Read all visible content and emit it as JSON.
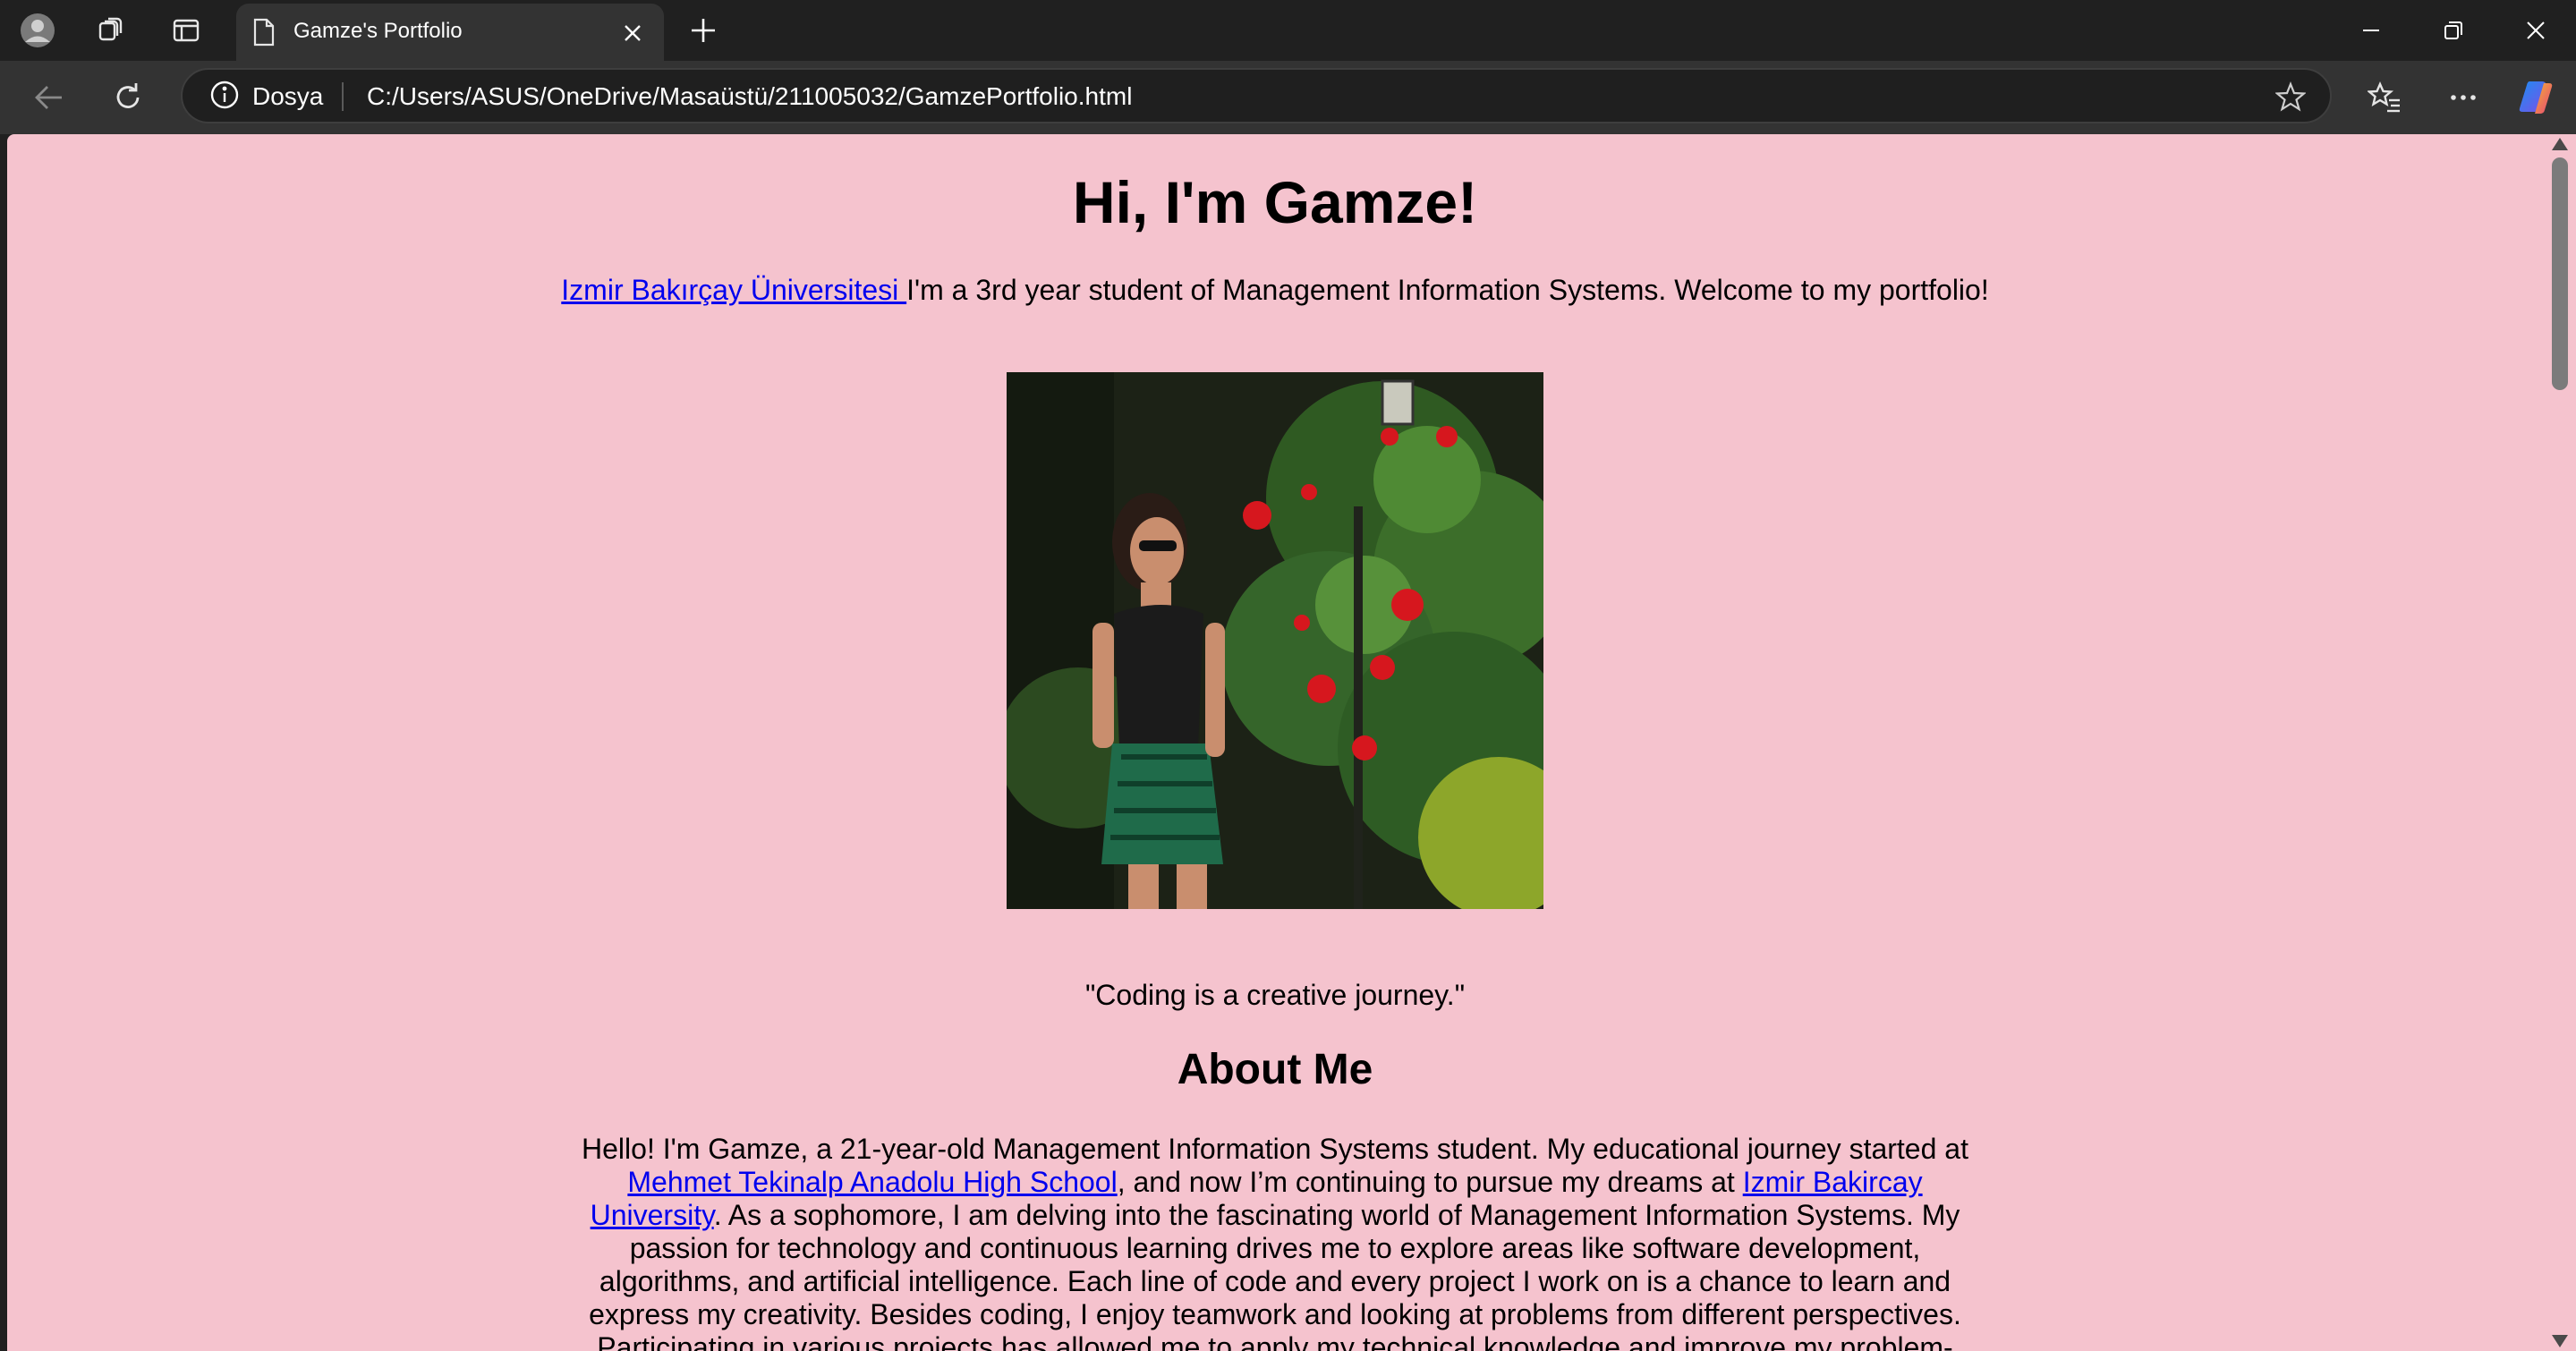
{
  "browser": {
    "tab": {
      "title": "Gamze's Portfolio",
      "icon": "page-icon"
    },
    "address": {
      "site_info_label": "Dosya",
      "url": "C:/Users/ASUS/OneDrive/Masaüstü/211005032/GamzePortfolio.html"
    },
    "icons": [
      "profile-icon",
      "workspaces-icon",
      "tab-actions-icon",
      "close-icon",
      "new-tab-icon",
      "minimize-icon",
      "restore-icon",
      "close-window-icon",
      "back-icon",
      "refresh-icon",
      "info-icon",
      "favorite-star-icon",
      "favorites-icon",
      "more-icon",
      "copilot-icon"
    ]
  },
  "page": {
    "heading": "Hi, I'm Gamze!",
    "intro": {
      "link_text": "Izmir Bakırçay Üniversitesi ",
      "text": "I'm a 3rd year student of Management Information Systems. Welcome to my portfolio!"
    },
    "quote": "\"Coding is a creative journey.\"",
    "about": {
      "heading": "About Me",
      "part1": "Hello! I'm Gamze, a 21-year-old Management Information Systems student. My educational journey started at ",
      "school_link": "Mehmet Tekinalp Anadolu High School",
      "part2": ", and now I’m continuing to pursue my dreams at ",
      "university_link": "Izmir Bakircay University",
      "part3": ". As a sophomore, I am delving into the fascinating world of Management Information Systems. My passion for technology and continuous learning drives me to explore areas like software development, algorithms, and artificial intelligence. Each line of code and every project I work on is a chance to learn and express my creativity. Besides coding, I enjoy teamwork and looking at problems from different perspectives. Participating in various projects has allowed me to apply my technical knowledge and improve my problem-solving skills."
    }
  },
  "colors": {
    "page_background": "#f5c3ce",
    "link": "#0000ee",
    "browser_chrome": "#202020",
    "toolbar": "#333333"
  }
}
